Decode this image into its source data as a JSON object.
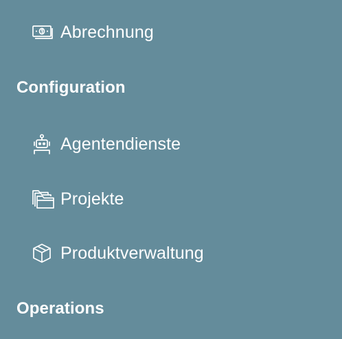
{
  "nav": {
    "items": [
      {
        "label": "Abrechnung",
        "icon": "money-bill-icon"
      },
      {
        "label": "Agentendienste",
        "icon": "robot-icon"
      },
      {
        "label": "Projekte",
        "icon": "folders-icon"
      },
      {
        "label": "Produktverwaltung",
        "icon": "box-icon"
      }
    ],
    "sections": [
      {
        "label": "Configuration"
      },
      {
        "label": "Operations"
      }
    ]
  },
  "colors": {
    "background": "#648c9b",
    "text": "#ffffff"
  }
}
